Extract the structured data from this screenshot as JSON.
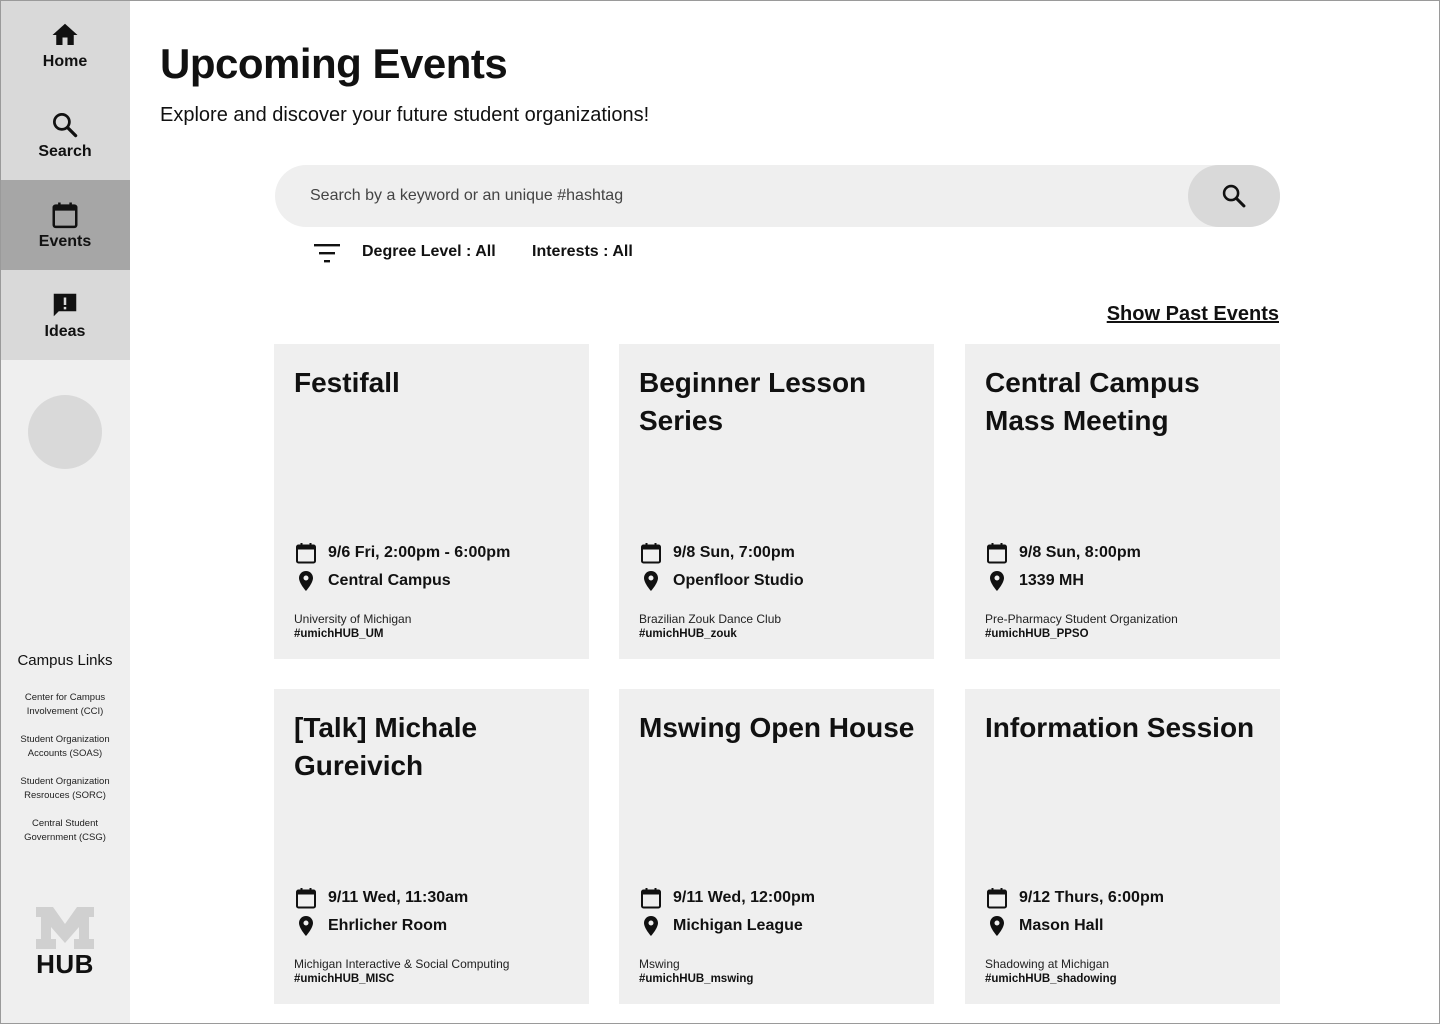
{
  "sidebar": {
    "nav": [
      {
        "label": "Home",
        "icon": "home-icon"
      },
      {
        "label": "Search",
        "icon": "search-icon"
      },
      {
        "label": "Events",
        "icon": "calendar-icon",
        "active": true
      },
      {
        "label": "Ideas",
        "icon": "feedback-icon"
      }
    ],
    "links_title": "Campus Links",
    "links": [
      [
        "Center for Campus",
        "Involvement (CCI)"
      ],
      [
        "Student Organization",
        "Accounts (SOAS)"
      ],
      [
        "Student Organization",
        "Resrouces (SORC)"
      ],
      [
        "Central Student",
        "Government (CSG)"
      ]
    ],
    "logo_text": "HUB"
  },
  "header": {
    "title": "Upcoming Events",
    "subtitle": "Explore and discover your future student organizations!"
  },
  "search": {
    "placeholder": "Search by a keyword or an unique #hashtag",
    "value": ""
  },
  "filters": {
    "degree_level": "Degree Level : All",
    "interests": "Interests : All"
  },
  "show_past_events": "Show Past Events",
  "events": [
    {
      "title": "Festifall",
      "datetime": "9/6 Fri, 2:00pm - 6:00pm",
      "location": "Central Campus",
      "org": "University of Michigan",
      "tag": "#umichHUB_UM"
    },
    {
      "title": "Beginner Lesson Series",
      "datetime": "9/8 Sun, 7:00pm",
      "location": "Openfloor Studio",
      "org": "Brazilian Zouk Dance Club",
      "tag": "#umichHUB_zouk"
    },
    {
      "title": "Central Campus Mass Meeting",
      "datetime": "9/8 Sun, 8:00pm",
      "location": "1339 MH",
      "org": "Pre-Pharmacy Student Organization",
      "tag": "#umichHUB_PPSO"
    },
    {
      "title": "[Talk] Michale Gureivich",
      "datetime": "9/11 Wed, 11:30am",
      "location": "Ehrlicher Room",
      "org": "Michigan Interactive & Social Computing",
      "tag": "#umichHUB_MISC"
    },
    {
      "title": "Mswing Open House",
      "datetime": "9/11 Wed, 12:00pm",
      "location": "Michigan League",
      "org": "Mswing",
      "tag": "#umichHUB_mswing"
    },
    {
      "title": "Information Session",
      "datetime": "9/12 Thurs, 6:00pm",
      "location": "Mason Hall",
      "org": "Shadowing at Michigan",
      "tag": "#umichHUB_shadowing"
    }
  ]
}
